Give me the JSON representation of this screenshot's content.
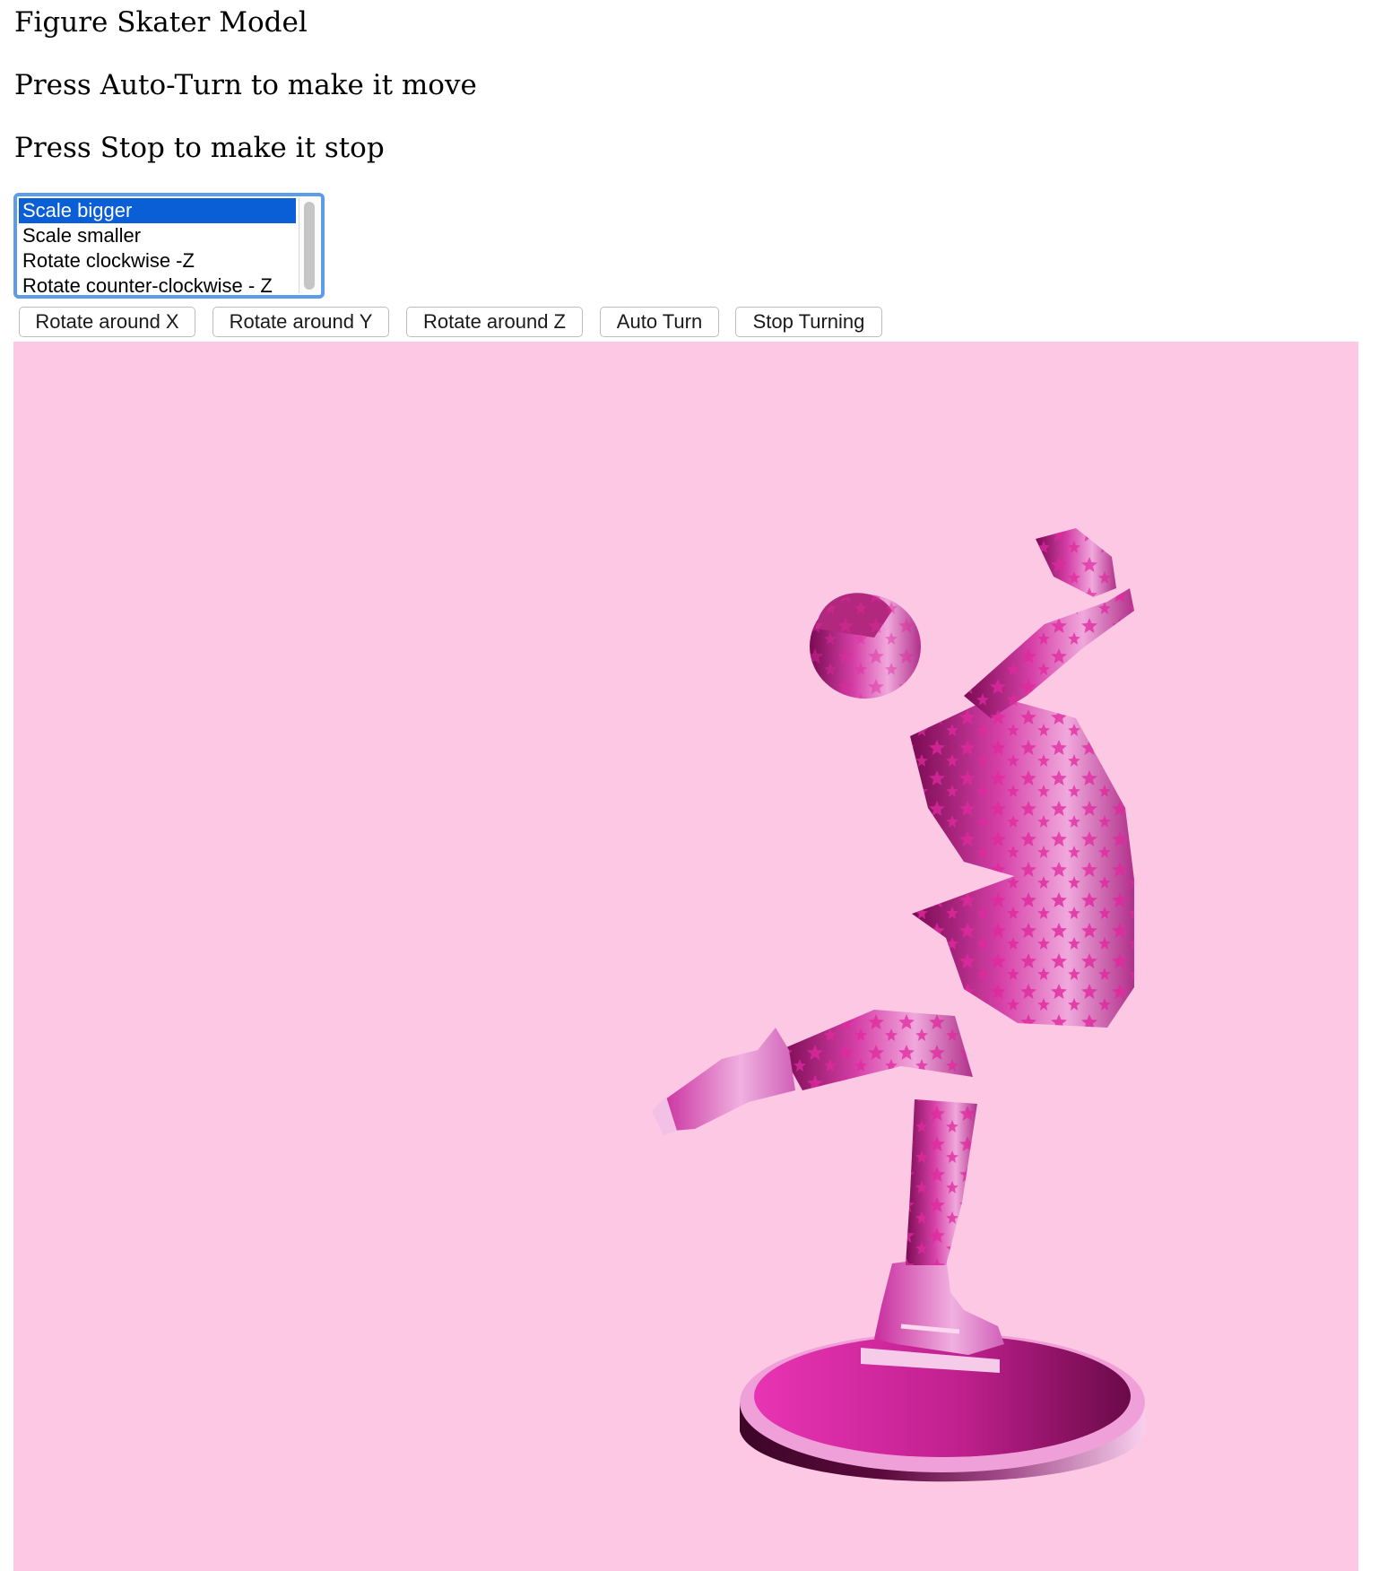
{
  "page": {
    "title": "Figure Skater Model",
    "line1": "Press Auto-Turn to make it move",
    "line2": "Press Stop to make it stop"
  },
  "transform_list": {
    "options": [
      "Scale bigger",
      "Scale smaller",
      "Rotate clockwise -Z",
      "Rotate counter-clockwise - Z"
    ],
    "selected": "Scale bigger"
  },
  "buttons": {
    "rotate_x": "Rotate around X",
    "rotate_y": "Rotate around Y",
    "rotate_z": "Rotate around Z",
    "auto_turn": "Auto Turn",
    "stop_turning": "Stop Turning"
  },
  "viewport": {
    "background_color": "#fdc8e4",
    "model": "figure skater on pedestal",
    "model_colors": {
      "primary": "#e23ab3",
      "dark": "#7a0a52",
      "light": "#f7c0e8"
    }
  },
  "colors": {
    "focus_ring": "#5c9ceb",
    "selection": "#0a5ed6"
  }
}
